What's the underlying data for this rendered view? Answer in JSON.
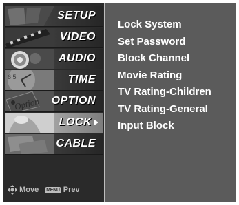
{
  "sidebar": {
    "items": [
      {
        "label": "SETUP"
      },
      {
        "label": "VIDEO"
      },
      {
        "label": "AUDIO"
      },
      {
        "label": "TIME"
      },
      {
        "label": "OPTION"
      },
      {
        "label": "LOCK"
      },
      {
        "label": "CABLE"
      }
    ],
    "active_index": 5
  },
  "footer": {
    "move_label": "Move",
    "menu_key_label": "MENU",
    "prev_label": "Prev"
  },
  "submenu": {
    "items": [
      {
        "label": "Lock System"
      },
      {
        "label": "Set Password"
      },
      {
        "label": "Block Channel"
      },
      {
        "label": "Movie Rating"
      },
      {
        "label": "TV Rating-Children"
      },
      {
        "label": "TV Rating-General"
      },
      {
        "label": "Input Block"
      }
    ]
  },
  "thumbnails": {
    "time_clock_digits": "6 5"
  },
  "colors": {
    "panel": "#5b5b5b",
    "sidebar": "#2a2a2a",
    "active_item": "#b5b5b5",
    "text": "#ffffff"
  }
}
